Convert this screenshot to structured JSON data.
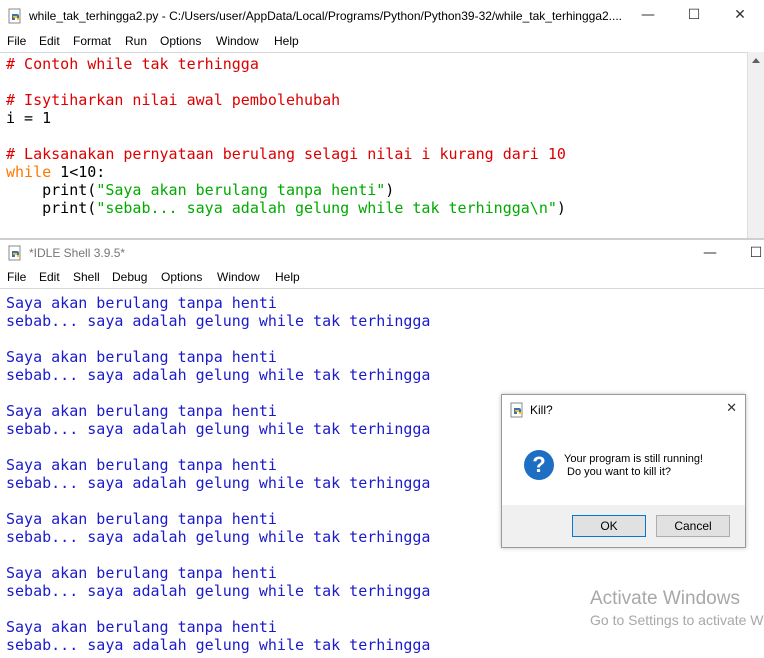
{
  "editor": {
    "title": "while_tak_terhingga2.py - C:/Users/user/AppData/Local/Programs/Python/Python39-32/while_tak_terhingga2....",
    "menu": [
      "File",
      "Edit",
      "Format",
      "Run",
      "Options",
      "Window",
      "Help"
    ],
    "code": {
      "line1": "# Contoh while tak terhingga",
      "line3": "# Isytiharkan nilai awal pembolehubah",
      "line4": "i = 1",
      "line6": "# Laksanakan pernyataan berulang selagi nilai i kurang dari 10",
      "line7_kw": "while",
      "line7_rest": " 1<10:",
      "line8_fn": "    print(",
      "line8_str": "\"Saya akan berulang tanpa henti\"",
      "line8_end": ")",
      "line9_fn": "    print(",
      "line9_str": "\"sebab... saya adalah gelung while tak terhingga\\n\"",
      "line9_end": ")"
    },
    "controls": {
      "minimize": "—",
      "maximize": "☐",
      "close": "✕"
    }
  },
  "shell": {
    "title": "*IDLE Shell 3.9.5*",
    "menu": [
      "File",
      "Edit",
      "Shell",
      "Debug",
      "Options",
      "Window",
      "Help"
    ],
    "output": [
      "Saya akan berulang tanpa henti",
      "sebab... saya adalah gelung while tak terhingga",
      "",
      "Saya akan berulang tanpa henti",
      "sebab... saya adalah gelung while tak terhingga",
      "",
      "Saya akan berulang tanpa henti",
      "sebab... saya adalah gelung while tak terhingga",
      "",
      "Saya akan berulang tanpa henti",
      "sebab... saya adalah gelung while tak terhingga",
      "",
      "Saya akan berulang tanpa henti",
      "sebab... saya adalah gelung while tak terhingga",
      "",
      "Saya akan berulang tanpa henti",
      "sebab... saya adalah gelung while tak terhingga",
      "",
      "Saya akan berulang tanpa henti",
      "sebab... saya adalah gelung while tak terhingga"
    ],
    "controls": {
      "minimize": "—",
      "maximize": "☐"
    }
  },
  "dialog": {
    "title": "Kill?",
    "message_line1": "Your program is still running!",
    "message_line2": " Do you want to kill it?",
    "ok_label": "OK",
    "cancel_label": "Cancel",
    "close": "✕",
    "icon_glyph": "?"
  },
  "watermark": {
    "line1": "Activate Windows",
    "line2": "Go to Settings to activate W"
  },
  "colors": {
    "comment": "#dd0000",
    "keyword": "#ff7700",
    "string": "#00aa00",
    "shell_output": "#1a1acc",
    "question_icon": "#1e6fc4"
  }
}
